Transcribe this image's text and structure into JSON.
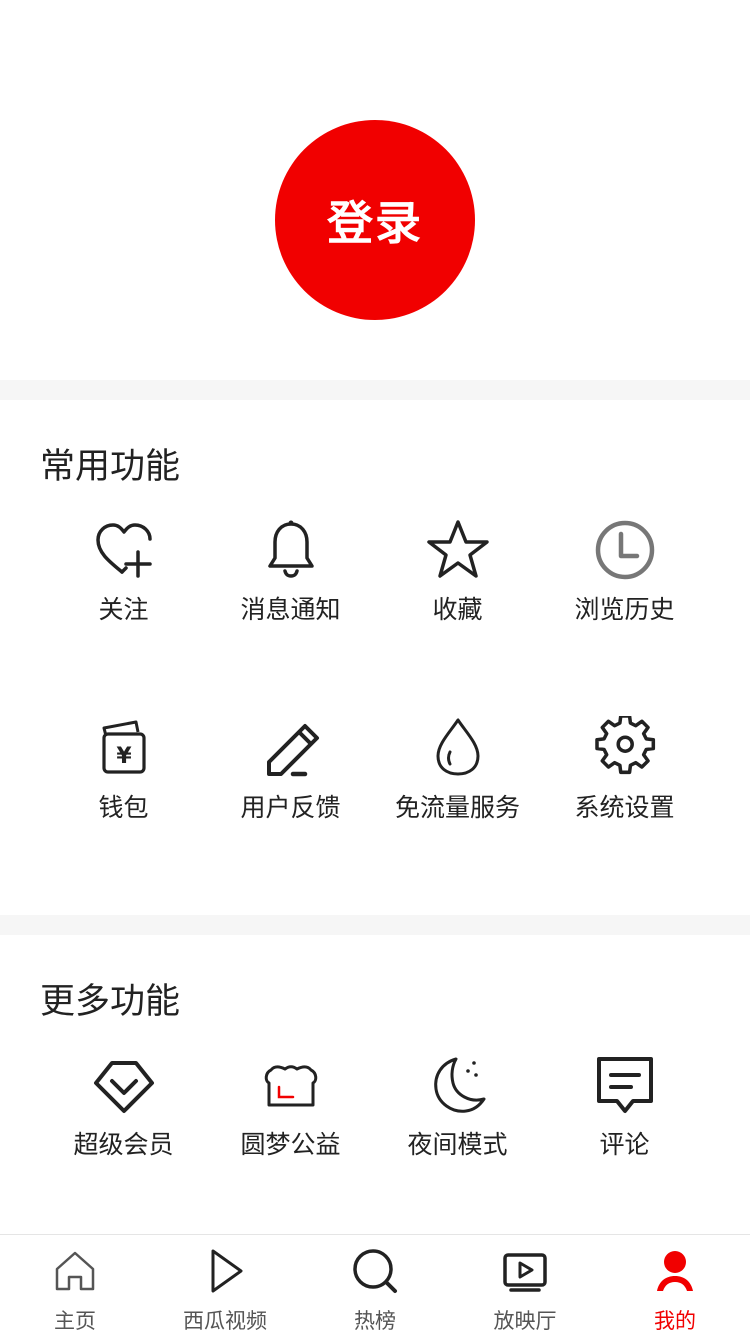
{
  "login": {
    "label": "登录"
  },
  "common": {
    "title": "常用功能",
    "items": [
      {
        "label": "关注",
        "icon": "heart-plus-icon"
      },
      {
        "label": "消息通知",
        "icon": "bell-icon"
      },
      {
        "label": "收藏",
        "icon": "star-icon"
      },
      {
        "label": "浏览历史",
        "icon": "clock-icon"
      },
      {
        "label": "钱包",
        "icon": "wallet-icon"
      },
      {
        "label": "用户反馈",
        "icon": "pencil-icon"
      },
      {
        "label": "免流量服务",
        "icon": "drop-icon"
      },
      {
        "label": "系统设置",
        "icon": "gear-icon"
      }
    ]
  },
  "more": {
    "title": "更多功能",
    "items": [
      {
        "label": "超级会员",
        "icon": "diamond-icon"
      },
      {
        "label": "圆梦公益",
        "icon": "bread-icon"
      },
      {
        "label": "夜间模式",
        "icon": "moon-icon"
      },
      {
        "label": "评论",
        "icon": "comment-icon"
      }
    ]
  },
  "tabs": [
    {
      "label": "主页",
      "icon": "home-icon",
      "active": false
    },
    {
      "label": "西瓜视频",
      "icon": "play-icon",
      "active": false
    },
    {
      "label": "热榜",
      "icon": "search-icon",
      "active": false
    },
    {
      "label": "放映厅",
      "icon": "video-icon",
      "active": false
    },
    {
      "label": "我的",
      "icon": "user-icon",
      "active": true
    }
  ],
  "colors": {
    "accent": "#f10000",
    "icon": "#222222",
    "tab_icon": "#333333",
    "separator": "#f6f6f6"
  }
}
